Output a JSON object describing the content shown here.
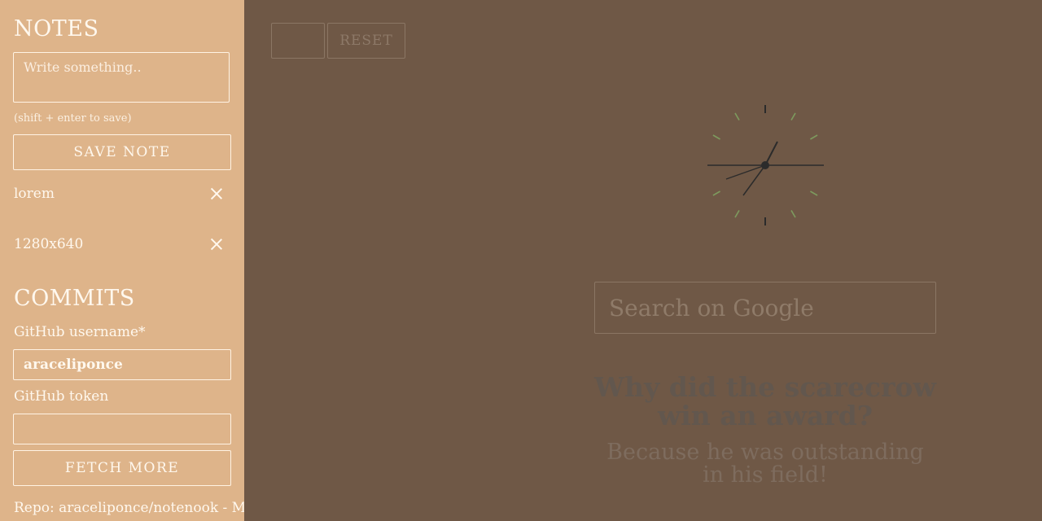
{
  "notes": {
    "title": "NOTES",
    "input_placeholder": "Write something..",
    "hint": "(shift + enter to save)",
    "save_label": "SAVE NOTE",
    "items": [
      {
        "label": "lorem"
      },
      {
        "label": "1280x640"
      }
    ]
  },
  "commits": {
    "title": "COMMITS",
    "username_label": "GitHub username*",
    "username_value": "araceliponce",
    "token_label": "GitHub token",
    "token_value": "",
    "fetch_label": "FETCH MORE",
    "repo_line": "Repo: araceliponce/notenook - M"
  },
  "toolbar": {
    "empty_button_label": "",
    "reset_label": "RESET"
  },
  "search": {
    "placeholder": "Search on Google"
  },
  "joke": {
    "question": "Why did the scarecrow win an award?",
    "answer": "Because he was outstanding in his field!"
  },
  "colors": {
    "sidebar_bg": "#deb48a",
    "main_bg": "#6f5846",
    "clock_tick_major": "#2b2b2b",
    "clock_tick_minor": "#7d9a5e"
  },
  "icons": {
    "delete": "close-icon",
    "clock": "analog-clock-icon"
  }
}
